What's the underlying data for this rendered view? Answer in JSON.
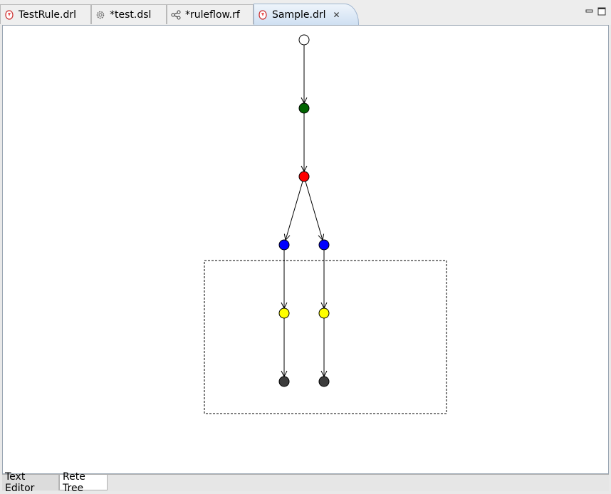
{
  "tabs": [
    {
      "label": "TestRule.drl",
      "icon": "drl-file-icon"
    },
    {
      "label": "*test.dsl",
      "icon": "gear-icon"
    },
    {
      "label": "*ruleflow.rf",
      "icon": "ruleflow-icon"
    },
    {
      "label": "Sample.drl",
      "icon": "drl-file-icon",
      "active": true
    }
  ],
  "bottom_tabs": [
    {
      "label": "Text Editor"
    },
    {
      "label": "Rete Tree",
      "active": true
    }
  ],
  "colors": {
    "node_root": "#ffffff",
    "node_green": "#006400",
    "node_red": "#ff0000",
    "node_blue": "#0000ff",
    "node_yellow": "#ffff00",
    "node_dark": "#3c3c3c",
    "active_tab": "#cfe0f2"
  },
  "rete": {
    "nodes": [
      {
        "id": "root",
        "color": "#ffffff"
      },
      {
        "id": "green",
        "color": "#006400"
      },
      {
        "id": "red",
        "color": "#ff0000"
      },
      {
        "id": "blue-left",
        "color": "#0000ff"
      },
      {
        "id": "blue-right",
        "color": "#0000ff"
      },
      {
        "id": "yellow-left",
        "color": "#ffff00"
      },
      {
        "id": "yellow-right",
        "color": "#ffff00"
      },
      {
        "id": "terminal-left",
        "color": "#3c3c3c"
      },
      {
        "id": "terminal-right",
        "color": "#3c3c3c"
      }
    ],
    "edges": [
      [
        "root",
        "green"
      ],
      [
        "green",
        "red"
      ],
      [
        "red",
        "blue-left"
      ],
      [
        "red",
        "blue-right"
      ],
      [
        "blue-left",
        "yellow-left"
      ],
      [
        "blue-right",
        "yellow-right"
      ],
      [
        "yellow-left",
        "terminal-left"
      ],
      [
        "yellow-right",
        "terminal-right"
      ]
    ]
  }
}
